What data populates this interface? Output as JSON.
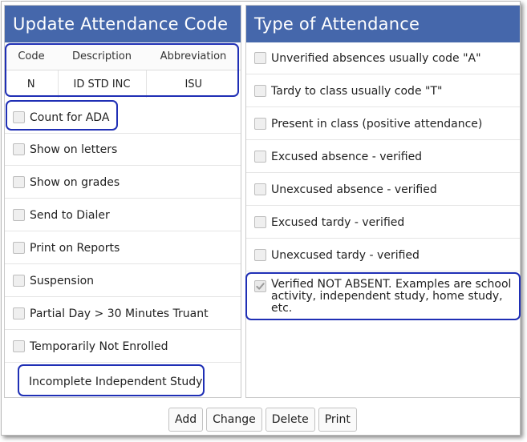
{
  "left_panel": {
    "title": "Update Attendance Code",
    "table": {
      "headers": [
        "Code",
        "Description",
        "Abbreviation"
      ],
      "row": [
        "N",
        "ID STD INC",
        "ISU"
      ]
    },
    "options": [
      {
        "label": "Count for ADA",
        "checked": false
      },
      {
        "label": "Show on letters",
        "checked": false
      },
      {
        "label": "Show on grades",
        "checked": false
      },
      {
        "label": "Send to Dialer",
        "checked": false
      },
      {
        "label": "Print on Reports",
        "checked": false
      },
      {
        "label": "Suspension",
        "checked": false
      },
      {
        "label": "Partial Day > 30 Minutes Truant",
        "checked": false
      },
      {
        "label": "Temporarily Not Enrolled",
        "checked": false
      },
      {
        "label": "Incomplete Independent Study",
        "checked": false
      }
    ]
  },
  "right_panel": {
    "title": "Type of Attendance",
    "options": [
      {
        "label": "Unverified absences usually code \"A\"",
        "checked": false
      },
      {
        "label": "Tardy to class usually code \"T\"",
        "checked": false
      },
      {
        "label": "Present in class (positive attendance)",
        "checked": false
      },
      {
        "label": "Excused absence - verified",
        "checked": false
      },
      {
        "label": "Unexcused absence - verified",
        "checked": false
      },
      {
        "label": "Excused tardy - verified",
        "checked": false
      },
      {
        "label": "Unexcused tardy - verified",
        "checked": false
      },
      {
        "label": "Verified NOT ABSENT. Examples are school activity, independent study, home study, etc.",
        "checked": true
      }
    ]
  },
  "buttons": {
    "add": "Add",
    "change": "Change",
    "delete": "Delete",
    "print": "Print"
  },
  "colors": {
    "header_bg": "#4567ab",
    "highlight_border": "#1f2fb5"
  }
}
